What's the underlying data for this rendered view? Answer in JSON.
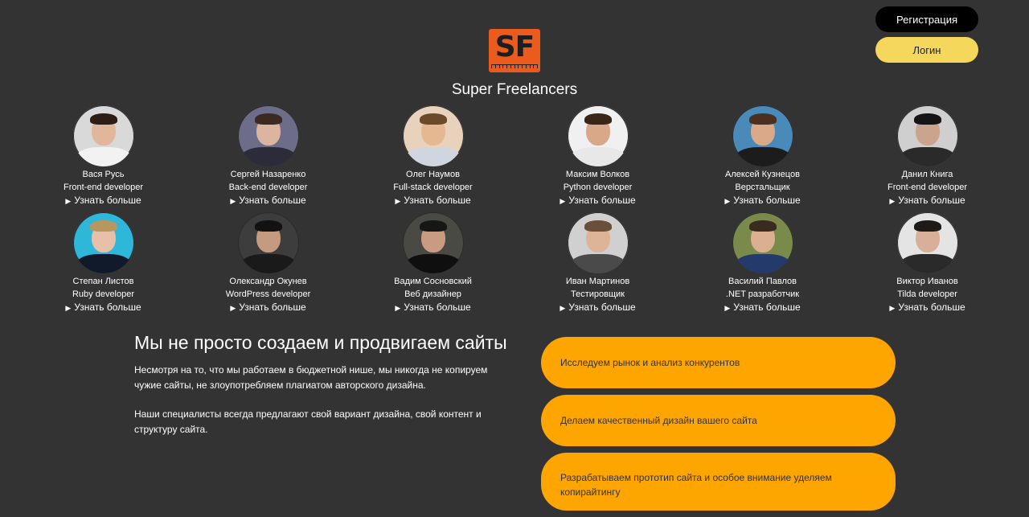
{
  "header": {
    "register_label": "Регистрация",
    "login_label": "Логин",
    "logo_text": "SF",
    "brand": "Super Freelancers"
  },
  "team": {
    "more_label": "Узнать больше",
    "members": [
      {
        "name": "Вася Русь",
        "role": "Front-end developer",
        "bg": "#d9d9d9",
        "skin": "#e0b79a",
        "hair": "#2c1e14",
        "shirt": "#f2f2f2"
      },
      {
        "name": "Сергей Назаренко",
        "role": "Back-end developer",
        "bg": "#6d6d8a",
        "skin": "#dcb5a0",
        "hair": "#3b2a22",
        "shirt": "#2b2b3a"
      },
      {
        "name": "Олег Наумов",
        "role": "Full-stack developer",
        "bg": "#e8d2bc",
        "skin": "#e6b892",
        "hair": "#6b4a2c",
        "shirt": "#cfd6e0"
      },
      {
        "name": "Максим Волков",
        "role": "Python developer",
        "bg": "#f0f0f0",
        "skin": "#d8a888",
        "hair": "#3a2616",
        "shirt": "#e8e8e8"
      },
      {
        "name": "Алексей Кузнецов",
        "role": "Верстальщик",
        "bg": "#4a8ab8",
        "skin": "#d9a98a",
        "hair": "#4a3020",
        "shirt": "#1c1c1c"
      },
      {
        "name": "Данил Книга",
        "role": "Front-end developer",
        "bg": "#cfcfcf",
        "skin": "#caa58c",
        "hair": "#151515",
        "shirt": "#2a2a2a"
      },
      {
        "name": "Степан Листов",
        "role": "Ruby developer",
        "bg": "#2fb7d9",
        "skin": "#e6c0a8",
        "hair": "#b89660",
        "shirt": "#111a2a"
      },
      {
        "name": "Олександр Окунев",
        "role": "WordPress developer",
        "bg": "#3d3d3d",
        "skin": "#c49a80",
        "hair": "#121212",
        "shirt": "#1a1a1a"
      },
      {
        "name": "Вадим Сосновский",
        "role": "Веб дизайнер",
        "bg": "#4a4a44",
        "skin": "#c99c82",
        "hair": "#161616",
        "shirt": "#0f0f0f"
      },
      {
        "name": "Иван Мартинов",
        "role": "Тестировщик",
        "bg": "#d0d0d0",
        "skin": "#ddb498",
        "hair": "#6a5038",
        "shirt": "#4a4a4a"
      },
      {
        "name": "Василий Павлов",
        "role": ".NET разработчик",
        "bg": "#7a8a4a",
        "skin": "#d9b090",
        "hair": "#3a2a20",
        "shirt": "#243a6a"
      },
      {
        "name": "Виктор Иванов",
        "role": "Tilda developer",
        "bg": "#e4e4e4",
        "skin": "#d8b09a",
        "hair": "#1e1a18",
        "shirt": "#2a2a2a"
      }
    ]
  },
  "about": {
    "title": "Мы не просто создаем и продвигаем сайты",
    "p1": "Несмотря на то, что мы работаем в бюджетной нише, мы никогда не копируем чужие сайты, не злоупотребляем плагиатом авторского дизайна.",
    "p2": "Наши специалисты всегда предлагают свой вариант дизайна, свой контент и структуру сайта."
  },
  "services": [
    "Исследуем рынок и анализ конкурентов",
    "Делаем качественный дизайн вашего сайта",
    "Разрабатываем прототип сайта и особое внимание уделяем копирайтингу"
  ],
  "colors": {
    "background": "#333333",
    "accent": "#ffa500",
    "login": "#f5d75c",
    "logo": "#ec5b1e"
  }
}
